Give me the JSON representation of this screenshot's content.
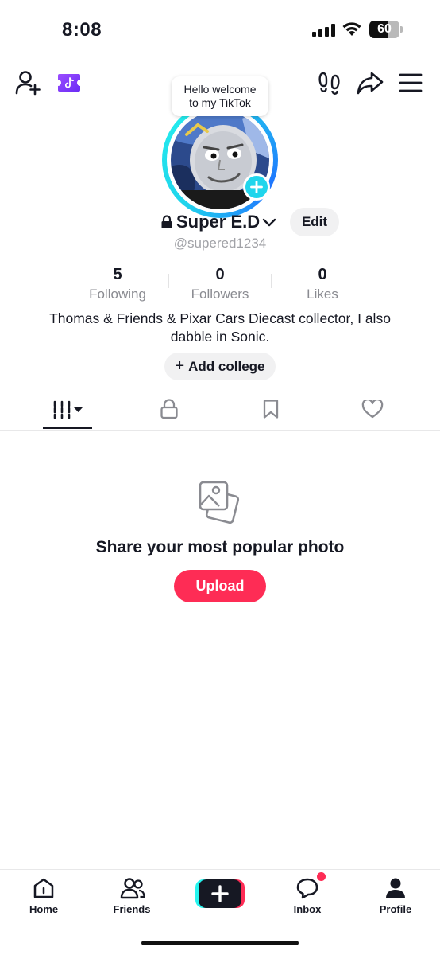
{
  "status_bar": {
    "time": "8:08",
    "battery_percent": "60",
    "battery_level": 0.6
  },
  "top_bar": {
    "icons": [
      "add-friend-icon",
      "tiktok-now-icon",
      "footprints-icon",
      "share-icon",
      "menu-icon"
    ]
  },
  "profile": {
    "bubble_line1": "Hello welcome",
    "bubble_line2": "to my TikTok",
    "display_name": "Super E.D",
    "edit_label": "Edit",
    "handle": "@supered1234",
    "stats": {
      "following_count": "5",
      "following_label": "Following",
      "followers_count": "0",
      "followers_label": "Followers",
      "likes_count": "0",
      "likes_label": "Likes"
    },
    "bio": "Thomas & Friends & Pixar Cars Diecast collector, I also dabble in Sonic.",
    "college_plus": "+",
    "college_label": "Add college"
  },
  "tabs": {
    "active": "videos",
    "items": [
      "videos-grid-icon",
      "lock-icon",
      "bookmark-icon",
      "heart-icon"
    ]
  },
  "empty_state": {
    "title": "Share your most popular photo",
    "button_label": "Upload"
  },
  "bottom_nav": {
    "home": "Home",
    "friends": "Friends",
    "inbox": "Inbox",
    "profile": "Profile"
  },
  "colors": {
    "accent_red": "#fe2c55",
    "accent_cyan": "#25f4ee",
    "text": "#161823",
    "muted": "#8a8b91"
  }
}
